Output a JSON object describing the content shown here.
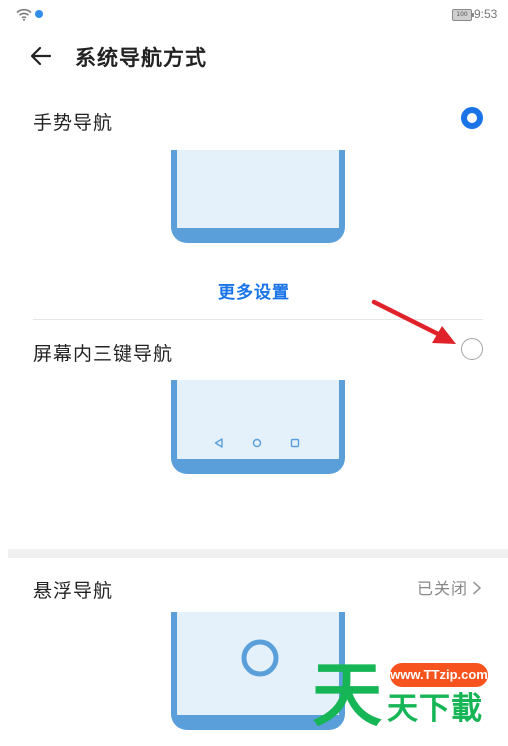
{
  "status_bar": {
    "battery_level": "100",
    "time": "9:53"
  },
  "header": {
    "title": "系统导航方式"
  },
  "options": {
    "gesture": {
      "label": "手势导航",
      "selected": true
    },
    "more_settings_label": "更多设置",
    "three_key": {
      "label": "屏幕内三键导航",
      "selected": false
    },
    "floating": {
      "label": "悬浮导航",
      "status": "已关闭"
    }
  },
  "watermark": {
    "url": "www.TTzip.com",
    "logo_char": "天",
    "text": "天下載"
  },
  "colors": {
    "accent": "#1a74e8",
    "phone_frame": "#5a9fd9",
    "phone_screen": "#e4f1fb",
    "annotation_arrow": "#e0232a",
    "watermark_green": "#16b556",
    "watermark_orange": "#f7531e"
  },
  "icons": {
    "back": "arrow-left-icon",
    "wifi": "wifi-icon",
    "battery": "battery-icon",
    "chevron": "chevron-right-icon",
    "nav_back": "triangle-back-icon",
    "nav_home": "circle-home-icon",
    "nav_recent": "square-recent-icon",
    "floating_button": "floating-ring-icon"
  }
}
